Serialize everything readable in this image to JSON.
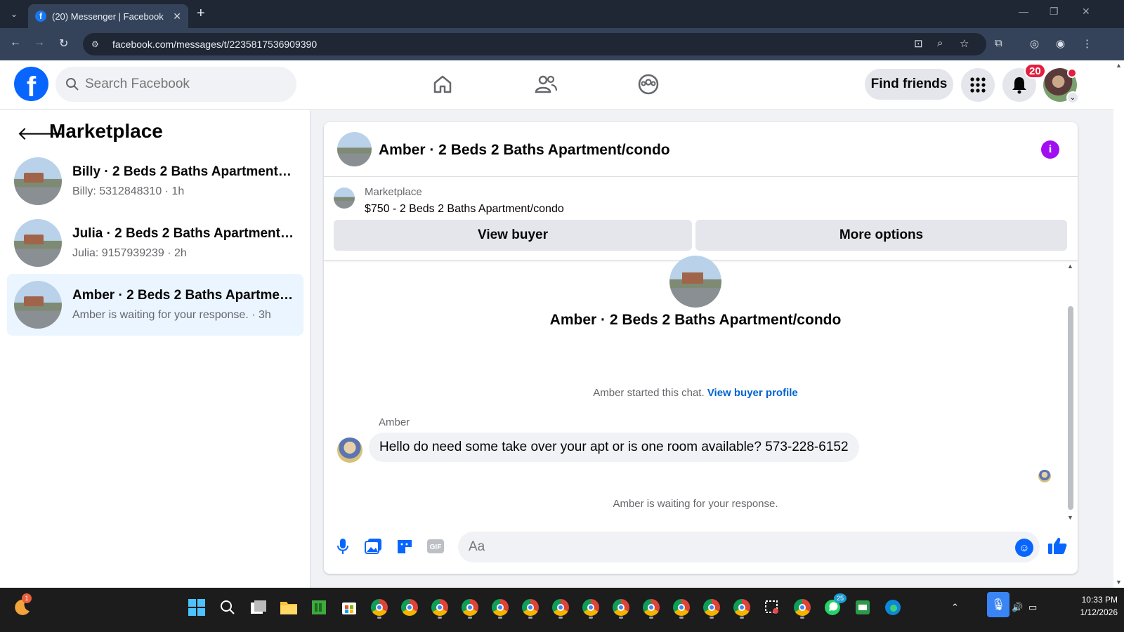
{
  "browser": {
    "tab_title": "(20) Messenger | Facebook",
    "url": "facebook.com/messages/t/2235817536909390"
  },
  "topnav": {
    "search_placeholder": "Search Facebook",
    "find_friends": "Find friends",
    "notification_count": "20"
  },
  "sidebar": {
    "title": "Marketplace",
    "conversations": [
      {
        "name": "Billy · 2 Beds 2 Baths Apartment/c...",
        "preview": "Billy: 5312848310 · 1h"
      },
      {
        "name": "Julia · 2 Beds 2 Baths Apartment/c...",
        "preview": "Julia: 9157939239 · 2h"
      },
      {
        "name": "Amber · 2 Beds 2 Baths Apartment...",
        "preview": "Amber is waiting for your response. · 3h"
      }
    ]
  },
  "chat": {
    "header_name": "Amber · 2 Beds 2 Baths Apartment/condo",
    "listing_label": "Marketplace",
    "listing_title": "$750 - 2 Beds 2 Baths Apartment/condo",
    "view_buyer": "View buyer",
    "more_options": "More options",
    "center_name": "Amber · 2 Beds 2 Baths Apartment/condo",
    "started_text": "Amber started this chat.",
    "view_buyer_profile": "View buyer profile",
    "sender": "Amber",
    "message": "Hello do need some take over your apt or is one room available? 573-228-6152",
    "waiting": "Amber is waiting for your response.",
    "composer_placeholder": "Aa"
  },
  "taskbar": {
    "time": "10:33 PM",
    "date": "1/12/2026",
    "whatsapp_badge": "25",
    "widget_badge": "1"
  },
  "colors": {
    "facebook_blue": "#0866ff",
    "link_blue": "#0064d1",
    "badge_red": "#e41e3f",
    "info_purple": "#a00ef2",
    "active_conv_bg": "#ebf5ff"
  }
}
